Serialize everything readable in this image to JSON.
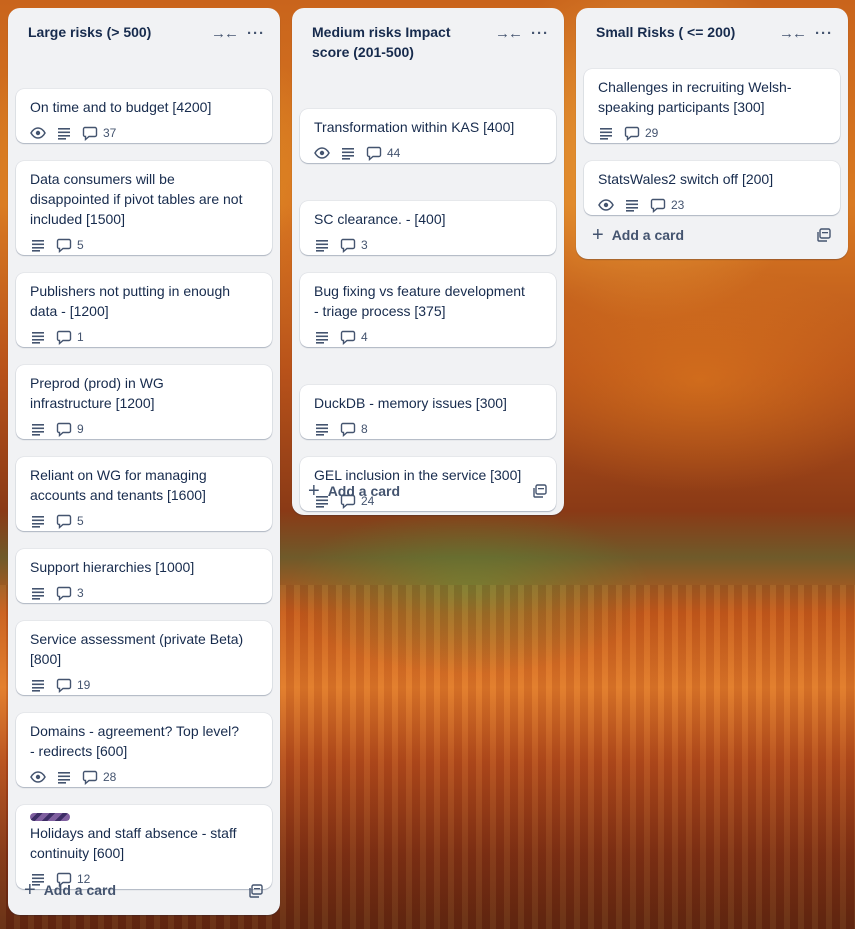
{
  "lists": [
    {
      "title": "Large risks (> 500)",
      "cards": [
        {
          "title": "On time and to budget [4200]",
          "watch": true,
          "description": true,
          "comments": "37"
        },
        {
          "title": "Data consumers will be disappointed if pivot tables are not included [1500]",
          "watch": false,
          "description": true,
          "comments": "5"
        },
        {
          "title": "Publishers not putting in enough data - [1200]",
          "watch": false,
          "description": true,
          "comments": "1"
        },
        {
          "title": "Preprod (prod) in WG infrastructure [1200]",
          "watch": false,
          "description": true,
          "comments": "9"
        },
        {
          "title": "Reliant on WG for managing accounts and tenants [1600]",
          "watch": false,
          "description": true,
          "comments": "5"
        },
        {
          "title": "Support hierarchies [1000]",
          "watch": false,
          "description": true,
          "comments": "3"
        },
        {
          "title": "Service assessment (private Beta) [800]",
          "watch": false,
          "description": true,
          "comments": "19"
        },
        {
          "title": "Domains - agreement? Top level? - redirects [600]",
          "watch": true,
          "description": true,
          "comments": "28"
        },
        {
          "title": "Holidays and staff absence - staff continuity [600]",
          "watch": false,
          "description": true,
          "comments": "12",
          "label": true
        }
      ],
      "add_label": "Add a card"
    },
    {
      "title": "Medium risks Impact score (201-500)",
      "cards": [
        {
          "title": "Transformation within KAS [400]",
          "watch": true,
          "description": true,
          "comments": "44"
        },
        {
          "title": "SC clearance. - [400]",
          "watch": false,
          "description": true,
          "comments": "3"
        },
        {
          "title": "Bug fixing vs feature development - triage process [375]",
          "watch": false,
          "description": true,
          "comments": "4"
        },
        {
          "title": "DuckDB - memory issues [300]",
          "watch": false,
          "description": true,
          "comments": "8"
        },
        {
          "title": "GEL inclusion in the service [300]",
          "watch": false,
          "description": true,
          "comments": "24"
        }
      ],
      "add_label": "Add a card"
    },
    {
      "title": "Small Risks ( <= 200)",
      "cards": [
        {
          "title": "Challenges in recruiting Welsh-speaking participants [300]",
          "watch": false,
          "description": true,
          "comments": "29"
        },
        {
          "title": "StatsWales2 switch off [200]",
          "watch": true,
          "description": true,
          "comments": "23"
        }
      ],
      "add_label": "Add a card"
    }
  ],
  "icons": {
    "collapse": "collapse-icon",
    "more": "more-icon",
    "watch": "eye-icon",
    "description": "description-icon",
    "comments": "comment-icon",
    "add": "plus-icon",
    "template": "template-icon"
  },
  "colors": {
    "list_bg": "#f1f2f4",
    "card_bg": "#ffffff",
    "text": "#172b4d",
    "muted": "#44546f",
    "label": "#7f5f9f"
  }
}
